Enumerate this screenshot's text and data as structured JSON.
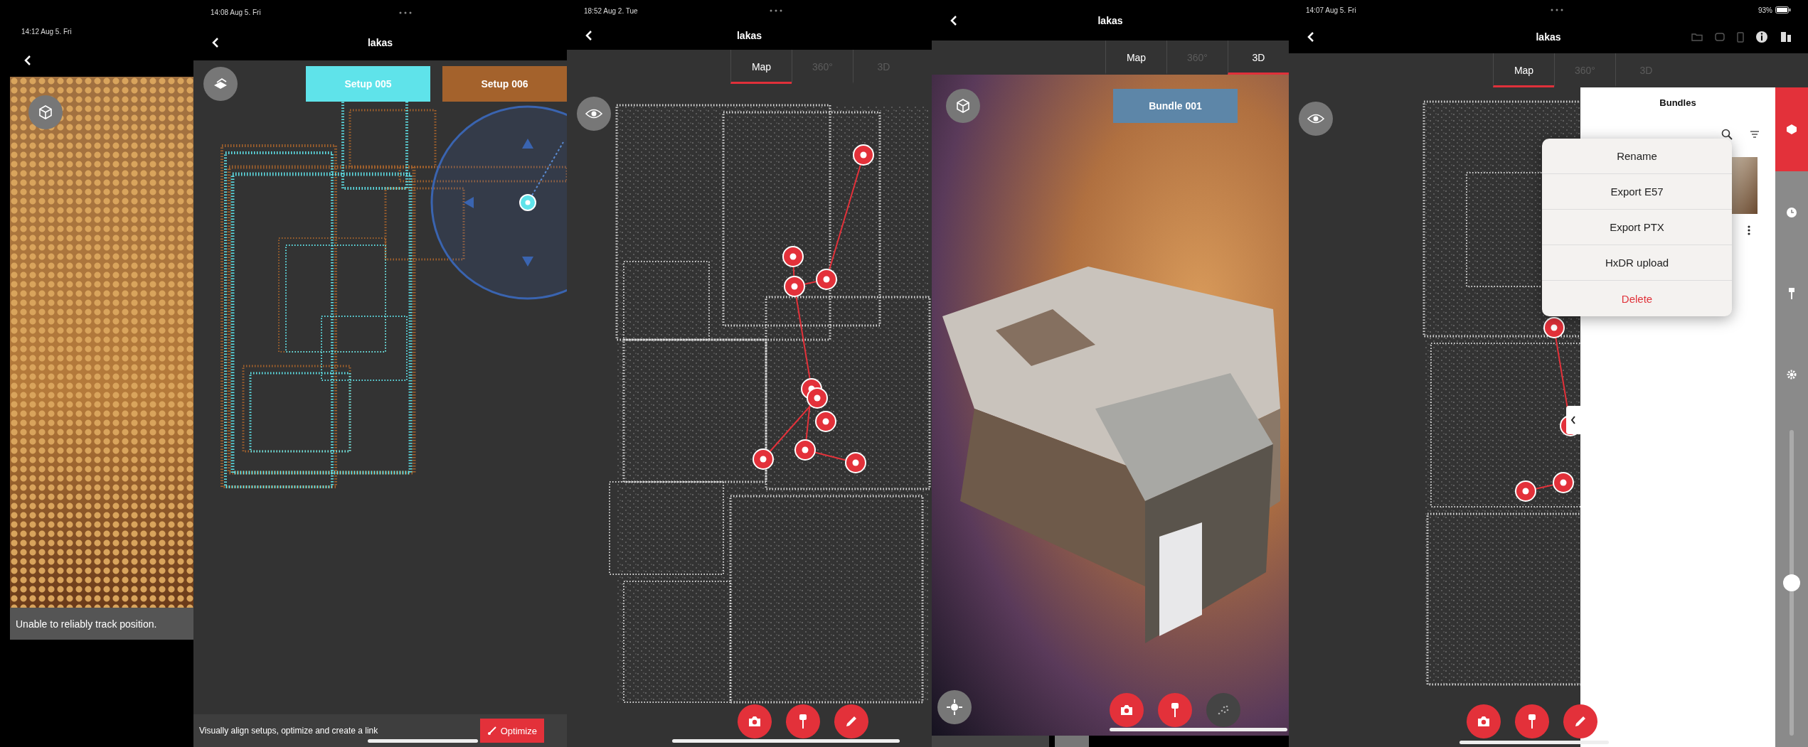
{
  "panels": [
    {
      "kind": "camera",
      "status": {
        "time": "14:12  Aug 5. Fri"
      },
      "message": "Unable to reliably track position."
    },
    {
      "kind": "align",
      "status": {
        "time": "14:08  Aug 5. Fri"
      },
      "title": "lakas",
      "setups": [
        {
          "label": "Setup 005",
          "color": "#5fe3ea"
        },
        {
          "label": "Setup 006",
          "color": "#a4622c"
        }
      ],
      "hint": "Visually align setups, optimize and create a link",
      "optimize_button": "Optimize"
    },
    {
      "kind": "map",
      "status": {
        "time": "18:52  Aug 2. Tue"
      },
      "title": "lakas",
      "tabs": [
        {
          "label": "Map",
          "selected": true,
          "disabled": false
        },
        {
          "label": "360°",
          "selected": false,
          "disabled": true
        },
        {
          "label": "3D",
          "selected": false,
          "disabled": true
        }
      ],
      "tools": [
        {
          "kind": "camera",
          "disabled": false
        },
        {
          "kind": "pin",
          "disabled": false
        },
        {
          "kind": "pencil",
          "disabled": false
        }
      ]
    },
    {
      "kind": "model",
      "title": "lakas",
      "tabs": [
        {
          "label": "Map",
          "selected": false,
          "disabled": false
        },
        {
          "label": "360°",
          "selected": false,
          "disabled": true
        },
        {
          "label": "3D",
          "selected": true,
          "disabled": false
        }
      ],
      "bundle_label": "Bundle 001",
      "tools": [
        {
          "kind": "camera",
          "disabled": false
        },
        {
          "kind": "pin",
          "disabled": false
        },
        {
          "kind": "points",
          "disabled": true
        }
      ]
    },
    {
      "kind": "bundles",
      "status": {
        "time": "14:07  Aug 5. Fri",
        "battery": "93%"
      },
      "title": "lakas",
      "tabs": [
        {
          "label": "Map",
          "selected": true,
          "disabled": false
        },
        {
          "label": "360°",
          "selected": false,
          "disabled": true
        },
        {
          "label": "3D",
          "selected": false,
          "disabled": true
        }
      ],
      "side_title": "Bundles",
      "menu": [
        {
          "label": "Rename",
          "kind": "normal"
        },
        {
          "label": "Export E57",
          "kind": "normal"
        },
        {
          "label": "Export PTX",
          "kind": "normal"
        },
        {
          "label": "HxDR upload",
          "kind": "normal"
        },
        {
          "label": "Delete",
          "kind": "destructive"
        }
      ],
      "zoom_slider": {
        "level": 0.5
      },
      "tools": [
        {
          "kind": "camera",
          "disabled": false
        },
        {
          "kind": "pin",
          "disabled": false
        },
        {
          "kind": "pencil",
          "disabled": false
        }
      ]
    }
  ]
}
